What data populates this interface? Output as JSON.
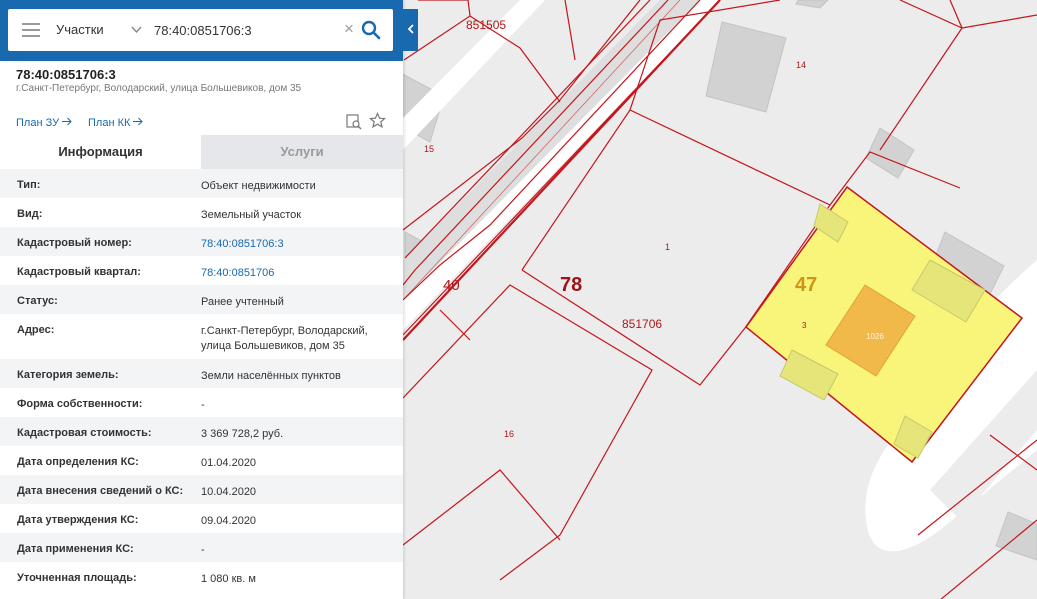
{
  "search": {
    "layer_label": "Участки",
    "query": "78:40:0851706:3"
  },
  "object": {
    "title": "78:40:0851706:3",
    "address": "г.Санкт-Петербург, Володарский, улица Большевиков, дом 35",
    "plan_zu": "План ЗУ",
    "plan_kk": "План КК"
  },
  "tabs": {
    "info": "Информация",
    "services": "Услуги"
  },
  "attributes": [
    {
      "key": "Тип:",
      "value": "Объект недвижимости"
    },
    {
      "key": "Вид:",
      "value": "Земельный участок"
    },
    {
      "key": "Кадастровый номер:",
      "value": "78:40:0851706:3"
    },
    {
      "key": "Кадастровый квартал:",
      "value": "78:40:0851706"
    },
    {
      "key": "Статус:",
      "value": "Ранее учтенный"
    },
    {
      "key": "Адрес:",
      "value": "г.Санкт-Петербург, Володарский, улица Большевиков, дом 35"
    },
    {
      "key": "Категория земель:",
      "value": "Земли населённых пунктов"
    },
    {
      "key": "Форма собственности:",
      "value": "-"
    },
    {
      "key": "Кадастровая стоимость:",
      "value": "3 369 728,2 руб."
    },
    {
      "key": "Дата определения КС:",
      "value": "01.04.2020"
    },
    {
      "key": "Дата внесения сведений о КС:",
      "value": "10.04.2020"
    },
    {
      "key": "Дата утверждения КС:",
      "value": "09.04.2020"
    },
    {
      "key": "Дата применения КС:",
      "value": "-"
    },
    {
      "key": "Уточненная площадь:",
      "value": "1 080 кв. м"
    }
  ],
  "map": {
    "labels": {
      "quarter_top": "851505",
      "parcel_14": "14",
      "parcel_15": "15",
      "parcel_1": "1",
      "district": "78",
      "zone": "47",
      "block_40": "40",
      "quarter": "851706",
      "parcel_3": "3",
      "building": "1026",
      "parcel_16": "16"
    }
  },
  "colors": {
    "header": "#1869ad",
    "link": "#1869ad",
    "boundary": "#c4161c",
    "selected_parcel": "#f8f57a",
    "building": "#f0b94a"
  },
  "icons": {
    "menu": "hamburger-icon",
    "dropdown": "chevron-down-icon",
    "clear": "close-icon",
    "search": "search-icon",
    "collapse": "chevron-left-icon",
    "arrow": "arrow-right-icon",
    "find_on_map": "find-on-map-icon",
    "favorite": "star-icon"
  }
}
